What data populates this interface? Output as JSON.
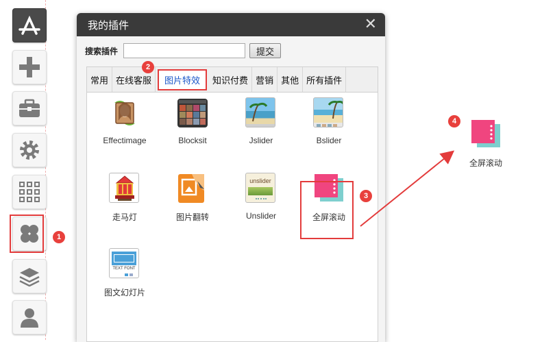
{
  "dialog": {
    "title": "我的插件",
    "search_label": "搜索插件",
    "search_value": "",
    "search_placeholder": "",
    "submit_label": "提交",
    "tabs": [
      "常用",
      "在线客服",
      "图片特效",
      "知识付费",
      "营销",
      "其他",
      "所有插件"
    ],
    "active_tab": "图片特效",
    "plugins": [
      {
        "label": "Effectimage",
        "icon": "effectimage-icon"
      },
      {
        "label": "Blocksit",
        "icon": "blocksit-icon"
      },
      {
        "label": "Jslider",
        "icon": "jslider-icon"
      },
      {
        "label": "Bslider",
        "icon": "bslider-icon"
      },
      {
        "label": "走马灯",
        "icon": "carousel-icon"
      },
      {
        "label": "图片翻转",
        "icon": "image-flip-icon"
      },
      {
        "label": "Unslider",
        "icon": "unslider-icon",
        "icon_text": "unslider"
      },
      {
        "label": "全屏滚动",
        "icon": "fullscreen-scroll-icon"
      },
      {
        "label": "图文幻灯片",
        "icon": "text-slide-icon",
        "icon_text": "TEXT FONT"
      }
    ]
  },
  "dragged": {
    "label": "全屏滚动",
    "icon": "fullscreen-scroll-icon"
  },
  "badges": [
    "1",
    "2",
    "3",
    "4"
  ],
  "toolbar": [
    "app-store-icon",
    "plus-icon",
    "toolbox-icon",
    "gear-icon",
    "grid-icon",
    "plugins-icon",
    "layers-icon",
    "user-icon"
  ],
  "colors": {
    "highlight": "#e33b3b",
    "badge": "#e8403c",
    "active_tab_text": "#1a56c8",
    "scroll_front": "#f0457f",
    "scroll_back": "#7ecfce"
  }
}
